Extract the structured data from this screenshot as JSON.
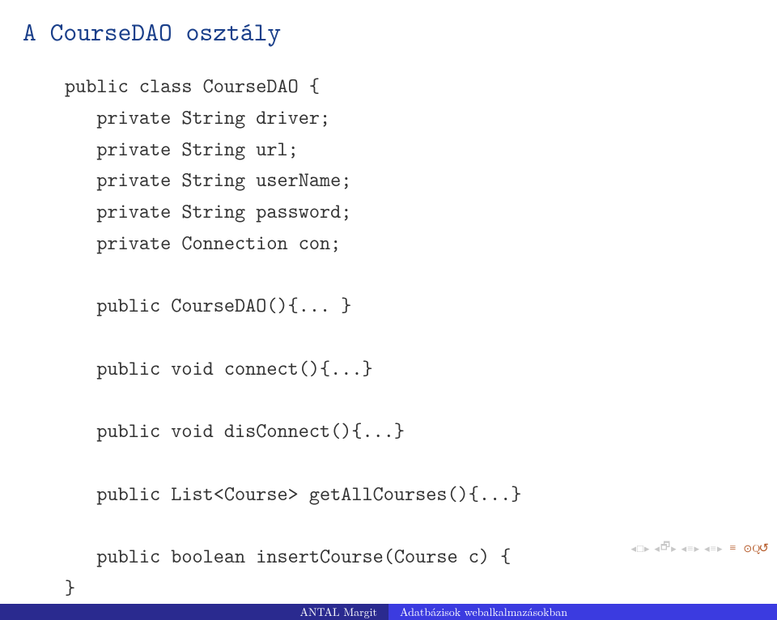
{
  "title": "A CourseDAO osztály",
  "code": {
    "l1": "public class CourseDAO {",
    "l2": "   private String driver;",
    "l3": "   private String url;",
    "l4": "   private String userName;",
    "l5": "   private String password;",
    "l6": "   private Connection con;",
    "l7": "",
    "l8": "   public CourseDAO(){... }",
    "l9": "",
    "l10": "   public void connect(){...}",
    "l11": "",
    "l12": "   public void disConnect(){...}",
    "l13": "",
    "l14": "   public List<Course> getAllCourses(){...}",
    "l15": "",
    "l16": "   public boolean insertCourse(Course c) {",
    "l17": "}"
  },
  "footer": {
    "author": "ANTAL Margit",
    "topic": "Adatbázisok webalkalmazásokban"
  }
}
